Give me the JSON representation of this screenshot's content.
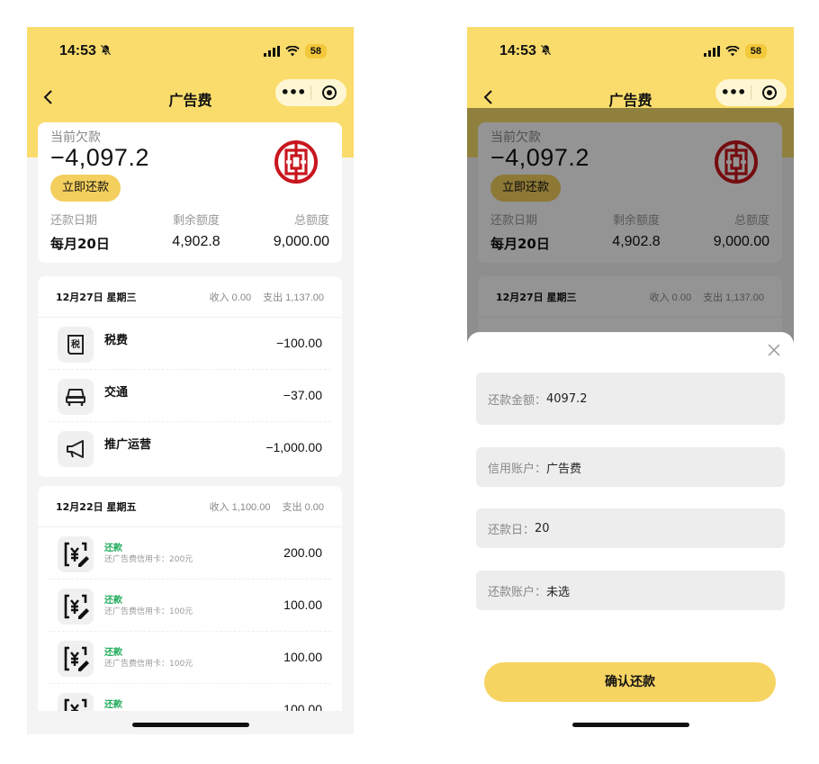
{
  "status": {
    "time": "14:53",
    "battery": "58"
  },
  "nav": {
    "title": "广告费",
    "more": "•••"
  },
  "account": {
    "debt_label": "当前欠款",
    "debt_amount": "−4,097.2",
    "repay_label": "立即还款",
    "repay_date_label": "还款日期",
    "repay_date_value": "每月20日",
    "remain_label": "剩余额度",
    "remain_value": "4,902.8",
    "total_label": "总额度",
    "total_value": "9,000.00"
  },
  "groups": [
    {
      "date": "12月27日 星期三",
      "income": "收入 0.00",
      "expense": "支出 1,137.00",
      "items": [
        {
          "icon": "tax-receipt-icon",
          "name": "税费",
          "amount": "−100.00"
        },
        {
          "icon": "car-icon",
          "name": "交通",
          "amount": "−37.00"
        },
        {
          "icon": "megaphone-icon",
          "name": "推广运营",
          "amount": "−1,000.00"
        }
      ]
    },
    {
      "date": "12月22日 星期五",
      "income": "收入 1,100.00",
      "expense": "支出 0.00",
      "items": [
        {
          "icon": "yuan-pen-icon",
          "name": "还款",
          "sub": "还广告费信用卡：200元",
          "amount": "200.00"
        },
        {
          "icon": "yuan-pen-icon",
          "name": "还款",
          "sub": "还广告费信用卡：100元",
          "amount": "100.00"
        },
        {
          "icon": "yuan-pen-icon",
          "name": "还款",
          "sub": "还广告费信用卡：100元",
          "amount": "100.00"
        },
        {
          "icon": "yuan-pen-icon",
          "name": "还款",
          "sub": "",
          "amount": "100.00"
        }
      ]
    }
  ],
  "sheet": {
    "amount_label": "还款金额：",
    "amount_value": "4097.2",
    "account_label": "信用账户：",
    "account_value": "广告费",
    "day_label": "还款日：",
    "day_value": "20",
    "source_label": "还款账户：",
    "source_value": "未选",
    "confirm_label": "确认还款"
  },
  "colors": {
    "brand_yellow": "#f9dc6b",
    "button_yellow": "#f6d462",
    "bank_red": "#c8161d",
    "green": "#27ae60"
  }
}
